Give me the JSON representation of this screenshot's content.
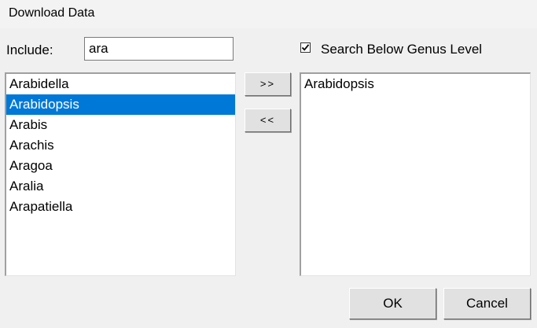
{
  "window": {
    "title": "Download Data"
  },
  "include": {
    "label": "Include:",
    "value": "ara"
  },
  "search_below": {
    "label": "Search Below Genus Level",
    "checked": true
  },
  "left_list": {
    "items": [
      "Arabidella",
      "Arabidopsis",
      "Arabis",
      "Arachis",
      "Aragoa",
      "Aralia",
      "Arapatiella"
    ],
    "selected": "Arabidopsis"
  },
  "right_list": {
    "items": [
      "Arabidopsis"
    ]
  },
  "buttons": {
    "add": ">>",
    "remove": "<<",
    "ok": "OK",
    "cancel": "Cancel"
  }
}
